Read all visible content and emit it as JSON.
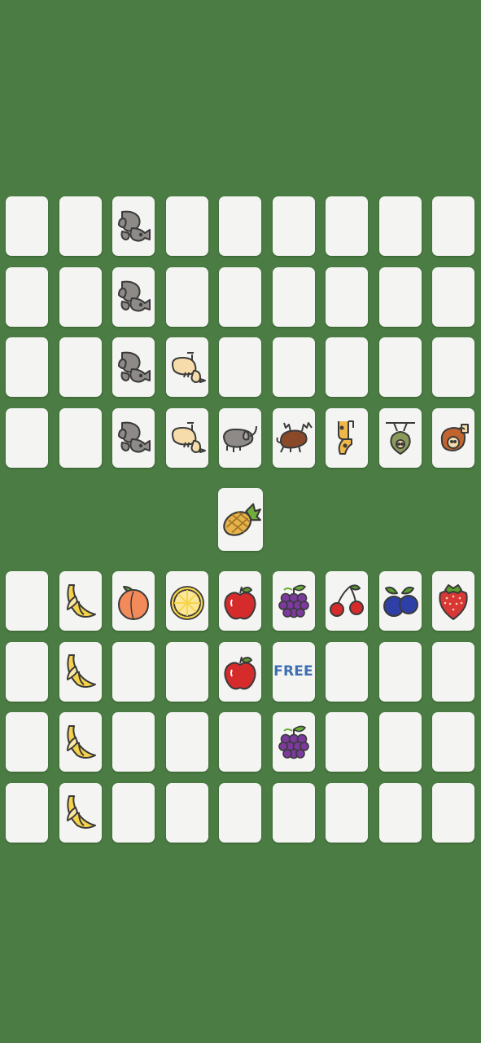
{
  "draw_pile": {
    "icon": "pineapple-icon"
  },
  "animal_board": {
    "rows": [
      [
        "",
        "",
        "cat-icon",
        "",
        "",
        "",
        "",
        "",
        ""
      ],
      [
        "",
        "",
        "cat-icon",
        "",
        "",
        "",
        "",
        "",
        ""
      ],
      [
        "",
        "",
        "cat-icon",
        "duck-icon",
        "",
        "",
        "",
        "",
        ""
      ],
      [
        "",
        "",
        "cat-icon",
        "duck-icon",
        "elephant-icon",
        "moose-icon",
        "giraffe-icon",
        "sloth-icon",
        "monkey-icon"
      ]
    ]
  },
  "fruit_board": {
    "rows": [
      [
        "",
        "banana-icon",
        "peach-icon",
        "lemon-icon",
        "apple-icon",
        "grapes-icon",
        "cherries-icon",
        "blueberries-icon",
        "strawberry-icon"
      ],
      [
        "",
        "banana-icon",
        "",
        "",
        "apple-icon",
        "FREE",
        "",
        "",
        ""
      ],
      [
        "",
        "banana-icon",
        "",
        "",
        "",
        "grapes-icon",
        "",
        "",
        ""
      ],
      [
        "",
        "banana-icon",
        "",
        "",
        "",
        "",
        "",
        "",
        ""
      ]
    ]
  },
  "colors": {
    "table": "#4a7c43",
    "card": "#f4f5f2",
    "free_text": "#3e6fb4"
  }
}
